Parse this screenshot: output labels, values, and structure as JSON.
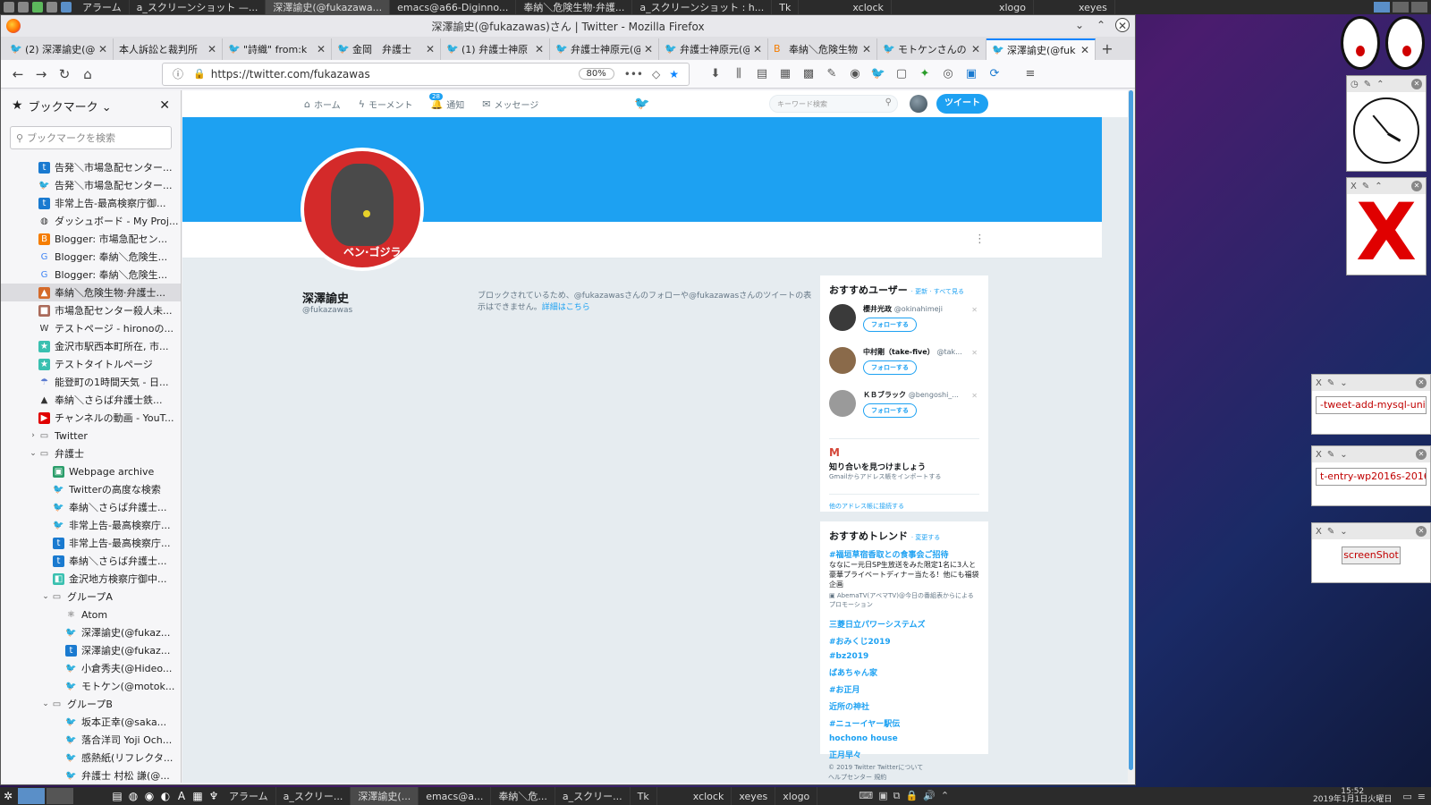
{
  "top_panel": {
    "tasks": [
      "アラーム",
      "a_スクリーンショット —...",
      "深澤諭史(@fukazawa...",
      "emacs@a66-Diginno...",
      "奉納＼危険生物·弁護...",
      "a_スクリーンショット : h...",
      "Tk",
      "xclock",
      "xlogo",
      "xeyes"
    ]
  },
  "window": {
    "title": "深澤諭史(@fukazawas)さん | Twitter - Mozilla Firefox"
  },
  "tabs": [
    {
      "title": "(2) 深澤諭史(@"
    },
    {
      "title": "本人訴訟と裁判所"
    },
    {
      "title": "\"詩織\" from:k"
    },
    {
      "title": "金岡　弁護士"
    },
    {
      "title": "(1) 弁護士神原"
    },
    {
      "title": "弁護士神原元(@"
    },
    {
      "title": "弁護士神原元(@"
    },
    {
      "title": "奉納＼危険生物"
    },
    {
      "title": "モトケンさんの"
    },
    {
      "title": "深澤諭史(@fuk"
    }
  ],
  "navbar": {
    "url": "https://twitter.com/fukazawas",
    "zoom": "80%"
  },
  "sidebar": {
    "title": "ブックマーク",
    "search_placeholder": "ブックマークを検索",
    "items": [
      {
        "label": "告発＼市場急配センター..."
      },
      {
        "label": "告発＼市場急配センター..."
      },
      {
        "label": "非常上告-最高検察庁御..."
      },
      {
        "label": "ダッシュボード - My Proj..."
      },
      {
        "label": "Blogger: 市場急配セン..."
      },
      {
        "label": "Blogger: 奉納＼危険生..."
      },
      {
        "label": "Blogger: 奉納＼危険生..."
      },
      {
        "label": "奉納＼危険生物·弁護士..."
      },
      {
        "label": "市場急配センター殺人未..."
      },
      {
        "label": "テストページ - hironoの..."
      },
      {
        "label": "金沢市駅西本町所在, 市..."
      },
      {
        "label": "テストタイトルページ"
      },
      {
        "label": "能登町の1時間天気 - 日..."
      },
      {
        "label": "奉納＼さらば弁護士鉄..."
      },
      {
        "label": "チャンネルの動画 - YouT..."
      },
      {
        "label": "Twitter"
      },
      {
        "label": "弁護士"
      },
      {
        "label": "Webpage archive"
      },
      {
        "label": "Twitterの高度な検索"
      },
      {
        "label": "奉納＼さらば弁護士..."
      },
      {
        "label": "非常上告-最高検察庁..."
      },
      {
        "label": "非常上告-最高検察庁..."
      },
      {
        "label": "奉納＼さらば弁護士..."
      },
      {
        "label": "金沢地方検察庁御中..."
      },
      {
        "label": "グループA"
      },
      {
        "label": "Atom"
      },
      {
        "label": "深澤諭史(@fukaz..."
      },
      {
        "label": "深澤諭史(@fukaz..."
      },
      {
        "label": "小倉秀夫(@Hideo..."
      },
      {
        "label": "モトケン(@motok..."
      },
      {
        "label": "グループB"
      },
      {
        "label": "坂本正幸(@saka..."
      },
      {
        "label": "落合洋司 Yoji Och..."
      },
      {
        "label": "感熱紙(リフレクタ..."
      },
      {
        "label": "弁護士 村松 謙(@..."
      }
    ]
  },
  "twitter": {
    "nav": {
      "home": "ホーム",
      "moments": "モーメント",
      "notifications": "通知",
      "notif_count": "28",
      "messages": "メッセージ"
    },
    "search_placeholder": "キーワード検索",
    "tweet_button": "ツイート",
    "profile": {
      "name": "深澤諭史",
      "handle": "@fukazawas",
      "avatar_text": "ベン·ゴジラ"
    },
    "blocked_message": "ブロックされているため、@fukazawasさんのフォローや@fukazawasさんのツイートの表示はできません。",
    "blocked_link": "詳細はこちら",
    "who_to_follow": {
      "title": "おすすめユーザー",
      "links": "· 更新 · すべて見る",
      "users": [
        {
          "name": "櫻井光政",
          "handle": "@okinahimeji",
          "follow": "フォローする",
          "color": "#3a3a3a"
        },
        {
          "name": "中村剛（take-five）",
          "handle": "@tak...",
          "follow": "フォローする",
          "color": "#8a6a4a"
        },
        {
          "name": "ＫＢブラック",
          "handle": "@bengoshi_...",
          "follow": "フォローする",
          "color": "#9a9a9a"
        }
      ],
      "gmail_title": "知り合いを見つけましょう",
      "gmail_sub": "Gmailからアドレス帳をインポートする",
      "gmail_link": "他のアドレス帳に接続する"
    },
    "trends": {
      "title": "おすすめトレンド",
      "change": "· 変更する",
      "promoted_title": "#福垣草宿香取との食事会ご招待",
      "promoted_desc": "ななにー元日SP生放送をみた限定1名に3人と豪華プライベートディナー当たる！他にも福袋企画",
      "promoted_by": "AbemaTV(アベマTV)@今日の番組表からによるプロモーション",
      "items": [
        "三菱日立パワーシステムズ",
        "#おみくじ2019",
        "#bz2019",
        "ばあちゃん家",
        "#お正月",
        "近所の神社",
        "#ニューイヤー駅伝",
        "hochono house",
        "正月早々"
      ]
    },
    "footer": {
      "line1": "© 2019 Twitter   Twitterについて",
      "line2": "ヘルプセンター   規約"
    }
  },
  "desktop": {
    "tk1_text": "-tweet-add-mysql-uniq.r",
    "tk2_text": "t-entry-wp2016s-20161",
    "tk3_button": "screenShot"
  },
  "bottom_panel": {
    "tasks": [
      "アラーム",
      "a_スクリー...",
      "深澤諭史(...",
      "emacs@a...",
      "奉納＼危...",
      "a_スクリー...",
      "Tk",
      "xclock",
      "xeyes",
      "xlogo"
    ],
    "time": "15:52",
    "date": "2019年1月1日火曜日"
  },
  "colors": {
    "twitter_blue": "#1da1f2",
    "firefox_accent": "#0a84ff"
  }
}
